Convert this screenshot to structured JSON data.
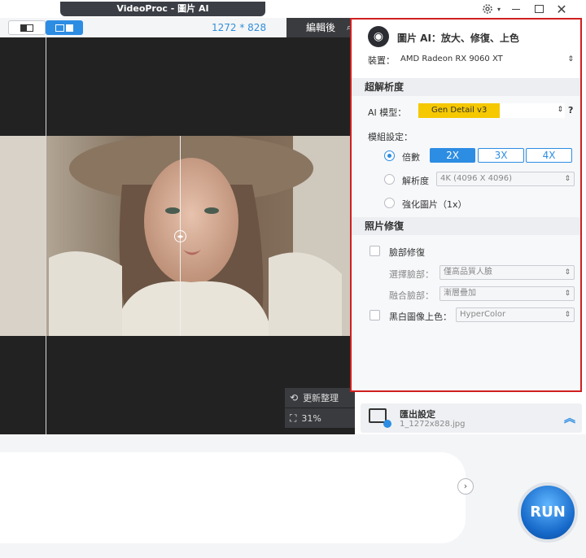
{
  "app": {
    "title": "VideoProc - 圖片 AI"
  },
  "toolbar": {
    "resolution": "1272 * 828",
    "edit_label": "編輯後"
  },
  "preview": {
    "refresh_label": "更新整理",
    "zoom_label": "31%"
  },
  "panel": {
    "header": "圖片 AI：放大、修復、上色",
    "device_label": "裝置：",
    "device_value": "AMD Radeon RX 9060 XT",
    "sr_section": "超解析度",
    "ai_model_label": "AI 模型：",
    "ai_model_value": "Gen Detail v3",
    "help": "?",
    "model_setting_label": "模組設定：",
    "scale_label": "倍數",
    "scales": [
      "2X",
      "3X",
      "4X"
    ],
    "resolution_label": "解析度",
    "resolution_value": "4K (4096 X 4096)",
    "enhance_label": "強化圖片（1x）",
    "restore_section": "照片修復",
    "face_label": "臉部修復",
    "select_face_label": "選擇臉部：",
    "select_face_value": "僅高品質人臉",
    "blend_face_label": "融合臉部：",
    "blend_face_value": "漸層疊加",
    "colorize_label": "黑白圖像上色：",
    "colorize_value": "HyperColor"
  },
  "export": {
    "title": "匯出設定",
    "file": "1_1272x828.jpg"
  },
  "run": {
    "label": "RUN"
  }
}
